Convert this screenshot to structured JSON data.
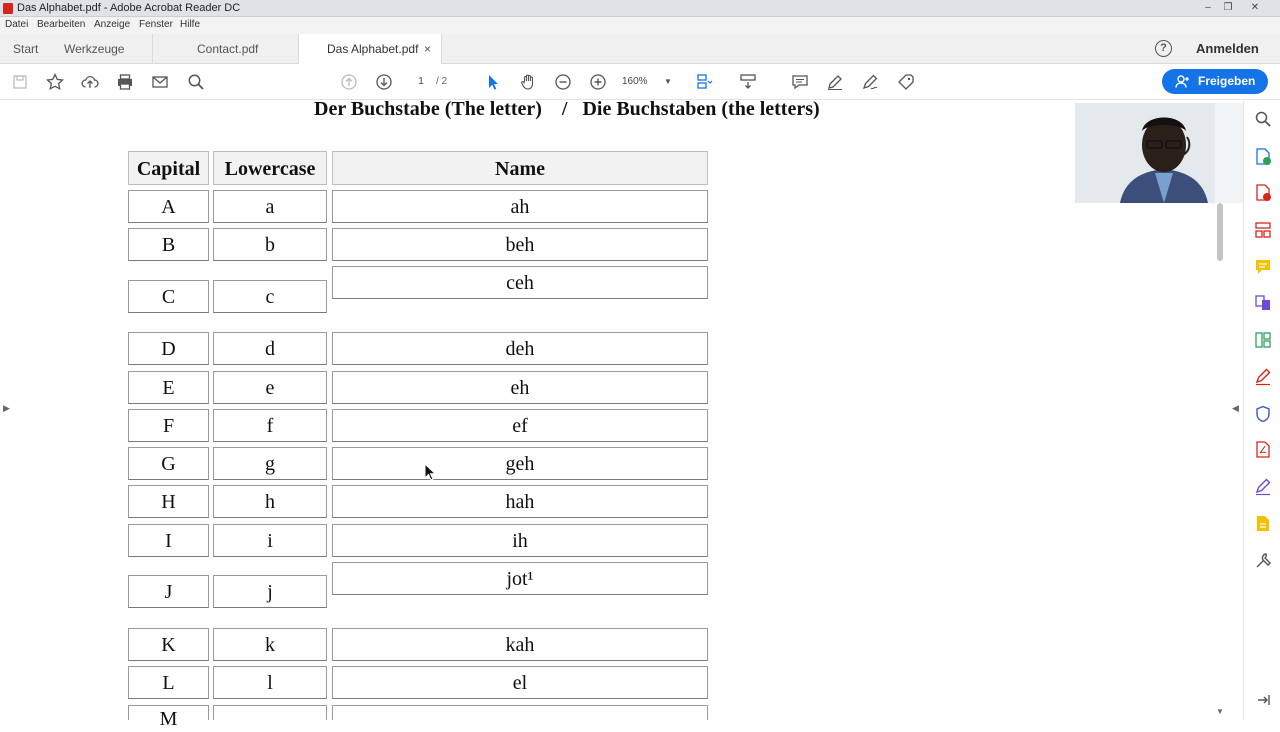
{
  "window": {
    "title": "Das Alphabet.pdf - Adobe Acrobat Reader DC"
  },
  "menu": [
    "Datei",
    "Bearbeiten",
    "Anzeige",
    "Fenster",
    "Hilfe"
  ],
  "tabs": {
    "start": "Start",
    "tools": "Werkzeuge",
    "doc1": "Contact.pdf",
    "doc2": "Das Alphabet.pdf",
    "close_glyph": "×"
  },
  "header": {
    "help_glyph": "?",
    "signin": "Anmelden"
  },
  "toolbar": {
    "page_current": "1",
    "page_total": "/ 2",
    "zoom": "160%",
    "share": "Freigeben"
  },
  "document": {
    "heading": "Der Buchstabe (The letter)    /   Die Buchstaben (the letters)",
    "columns": [
      "Capital",
      "Lowercase",
      "Name"
    ],
    "rows": [
      {
        "capital": "A",
        "lower": "a",
        "name": "ah"
      },
      {
        "capital": "B",
        "lower": "b",
        "name": "beh"
      },
      {
        "capital": "C",
        "lower": "c",
        "name": "ceh"
      },
      {
        "capital": "D",
        "lower": "d",
        "name": "deh"
      },
      {
        "capital": "E",
        "lower": "e",
        "name": "eh"
      },
      {
        "capital": "F",
        "lower": "f",
        "name": "ef"
      },
      {
        "capital": "G",
        "lower": "g",
        "name": "geh"
      },
      {
        "capital": "H",
        "lower": "h",
        "name": "hah"
      },
      {
        "capital": "I",
        "lower": "i",
        "name": "ih"
      },
      {
        "capital": "J",
        "lower": "j",
        "name": "jot¹"
      },
      {
        "capital": "K",
        "lower": "k",
        "name": "kah"
      },
      {
        "capital": "L",
        "lower": "l",
        "name": "el"
      },
      {
        "capital": "M",
        "lower": "",
        "name": ""
      }
    ]
  },
  "colors": {
    "accent": "#1473e6",
    "pdf_red": "#d9241b"
  }
}
